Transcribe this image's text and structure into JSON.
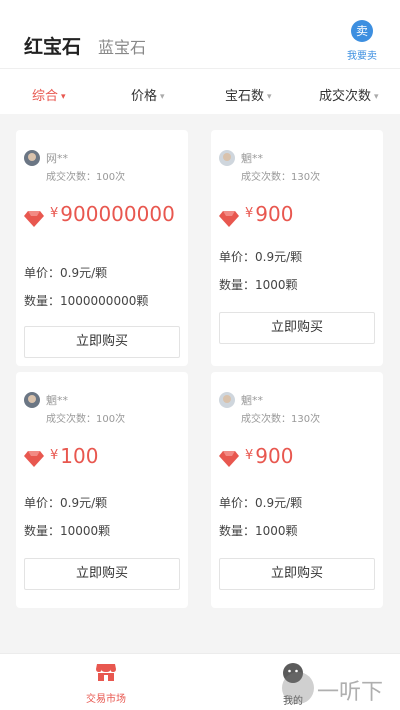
{
  "header": {
    "tab_active": "红宝石",
    "tab_inactive": "蓝宝石",
    "sell_icon_glyph": "卖",
    "sell_label": "我要卖"
  },
  "filters": [
    "综合",
    "价格",
    "宝石数",
    "成交次数"
  ],
  "listings": [
    {
      "seller": "网**",
      "trades": "成交次数：100次",
      "price_symbol": "¥",
      "price": "900000000",
      "unit_price": "单价：0.9元/颗",
      "quantity": "数量：1000000000颗",
      "buy_label": "立即购买"
    },
    {
      "seller": "魍**",
      "trades": "成交次数：130次",
      "price_symbol": "¥",
      "price": "900",
      "unit_price": "单价：0.9元/颗",
      "quantity": "数量：1000颗",
      "buy_label": "立即购买"
    },
    {
      "seller": "魍**",
      "trades": "成交次数：100次",
      "price_symbol": "¥",
      "price": "100",
      "unit_price": "单价：0.9元/颗",
      "quantity": "数量：10000颗",
      "buy_label": "立即购买"
    },
    {
      "seller": "魍**",
      "trades": "成交次数：130次",
      "price_symbol": "¥",
      "price": "900",
      "unit_price": "单价：0.9元/颗",
      "quantity": "数量：1000颗",
      "buy_label": "立即购买"
    }
  ],
  "bottom_nav": {
    "market_label": "交易市场",
    "mine_label": "我的"
  },
  "watermark_text": "一听下载",
  "colors": {
    "accent": "#e8574f",
    "blue": "#3d8fe0",
    "gem": "#e8574f"
  }
}
